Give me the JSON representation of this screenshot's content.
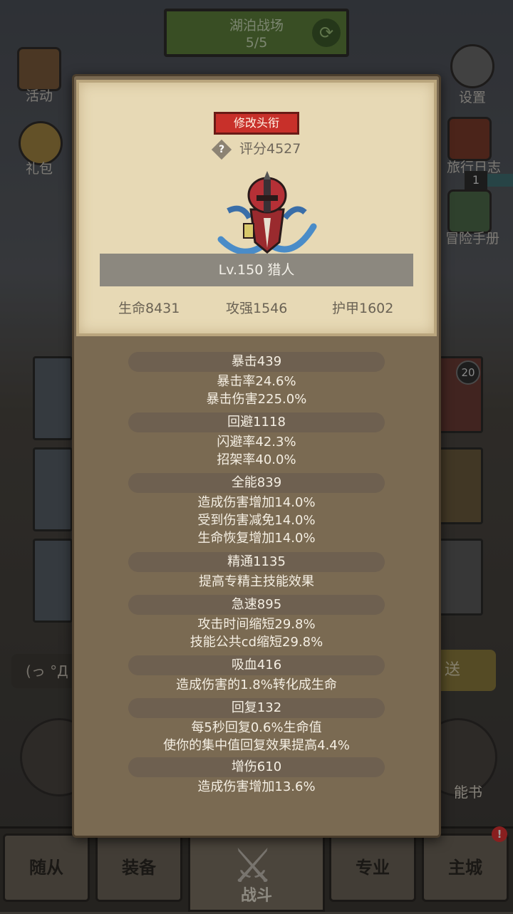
{
  "background": {
    "banner_title": "湖泊战场",
    "banner_progress": "5/5",
    "activity_label": "活动",
    "gift_label": "礼包",
    "settings_label": "设置",
    "travel_log_label": "旅行日志",
    "travel_log_count": "1",
    "adventure_handbook_label": "冒险手册",
    "card_badge": "20",
    "sign_text": "(っ °Д °",
    "send_label": "送",
    "skillbook_label": "能书",
    "alert_badge": "!"
  },
  "nav": {
    "companions": "随从",
    "equipment": "装备",
    "battle": "战斗",
    "profession": "专业",
    "main_city": "主城"
  },
  "profile": {
    "change_title_button": "修改头衔",
    "help_icon": "?",
    "score": "评分4527",
    "level_class": "Lv.150 猎人",
    "hp": "生命8431",
    "attack": "攻强1546",
    "armor": "护甲1602"
  },
  "stats": [
    {
      "title": "暴击439",
      "lines": [
        "暴击率24.6%",
        "暴击伤害225.0%"
      ]
    },
    {
      "title": "回避1118",
      "lines": [
        "闪避率42.3%",
        "招架率40.0%"
      ]
    },
    {
      "title": "全能839",
      "lines": [
        "造成伤害增加14.0%",
        "受到伤害减免14.0%",
        "生命恢复增加14.0%"
      ]
    },
    {
      "title": "精通1135",
      "lines": [
        "提高专精主技能效果"
      ]
    },
    {
      "title": "急速895",
      "lines": [
        "攻击时间缩短29.8%",
        "技能公共cd缩短29.8%"
      ]
    },
    {
      "title": "吸血416",
      "lines": [
        "造成伤害的1.8%转化成生命"
      ]
    },
    {
      "title": "回复132",
      "lines": [
        "每5秒回复0.6%生命值",
        "使你的集中值回复效果提高4.4%"
      ]
    },
    {
      "title": "增伤610",
      "lines": [
        "造成伤害增加13.6%"
      ]
    }
  ],
  "colors": {
    "title_button": "#c8302a",
    "paper": "#e7d9b5",
    "modal": "#7a6a52",
    "pill": "#6e6050"
  }
}
